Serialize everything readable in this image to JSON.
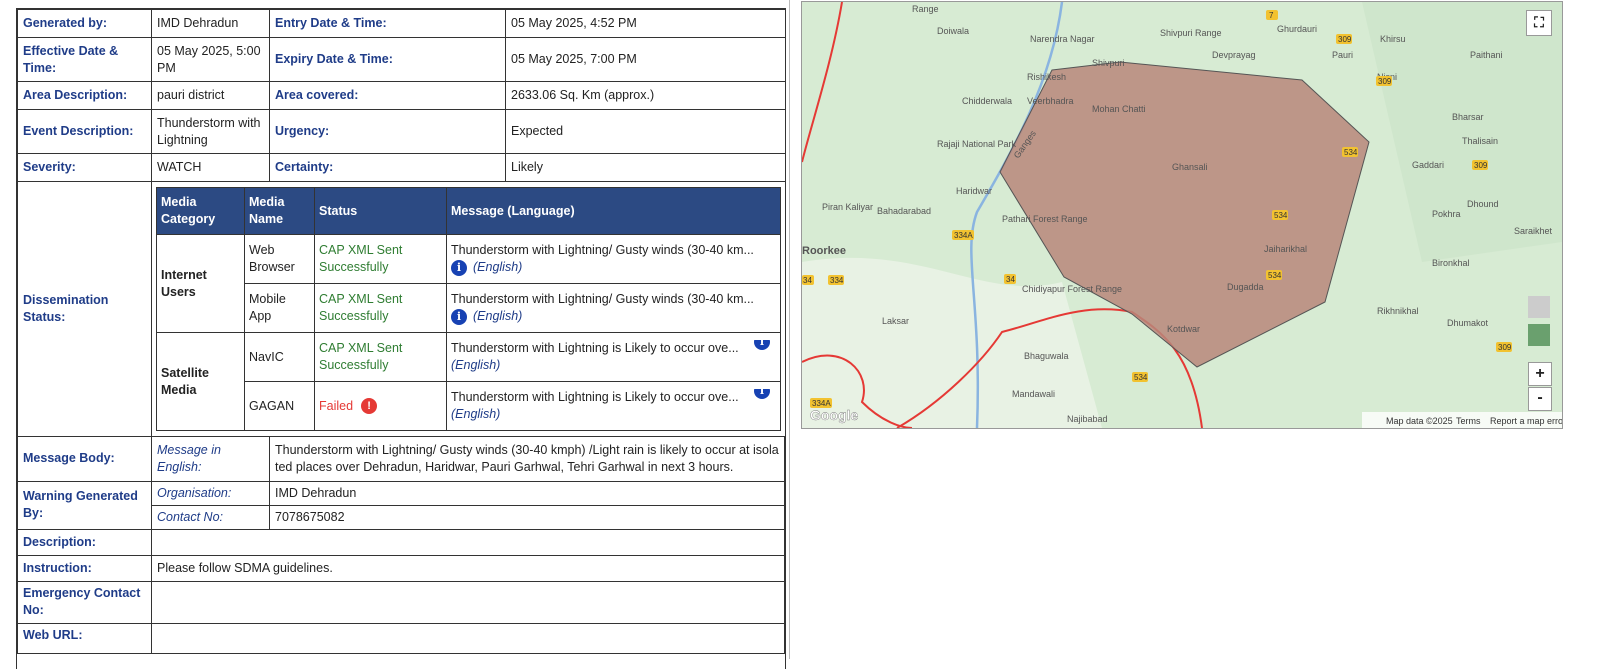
{
  "alert": {
    "generated_by_label": "Generated by:",
    "generated_by": "IMD Dehradun",
    "entry_label": "Entry Date & Time:",
    "entry": "05 May 2025, 4:52 PM",
    "effective_label": "Effective Date & Time:",
    "effective": "05 May 2025, 5:00 PM",
    "expiry_label": "Expiry Date & Time:",
    "expiry": "05 May 2025, 7:00 PM",
    "area_desc_label": "Area Description:",
    "area_desc": "pauri district",
    "area_covered_label": "Area covered:",
    "area_covered": "2633.06 Sq. Km (approx.)",
    "event_label": "Event Description:",
    "event": "Thunderstorm with Lightning",
    "urgency_label": "Urgency:",
    "urgency": "Expected",
    "severity_label": "Severity:",
    "severity": "WATCH",
    "certainty_label": "Certainty:",
    "certainty": "Likely",
    "dissemination_label": "Dissemination Status:"
  },
  "media_table": {
    "headers": [
      "Media Category",
      "Media Name",
      "Status",
      "Message (Language)"
    ],
    "groups": [
      {
        "category": "Internet Users",
        "rows": [
          {
            "name": "Web Browser",
            "status": "CAP XML Sent Successfully",
            "message": "Thunderstorm with Lightning/ Gusty winds (30-40 km...",
            "language": "(English)"
          },
          {
            "name": "Mobile App",
            "status": "CAP XML Sent Successfully",
            "message": "Thunderstorm with Lightning/ Gusty winds (30-40 km...",
            "language": "(English)"
          }
        ]
      },
      {
        "category": "Satellite Media",
        "rows": [
          {
            "name": "NavIC",
            "status": "CAP XML Sent Successfully",
            "message": "Thunderstorm with Lightning is Likely to occur ove...",
            "language": "(English)"
          },
          {
            "name": "GAGAN",
            "status": "Failed",
            "message": "Thunderstorm with Lightning is Likely to occur ove...",
            "language": "(English)"
          }
        ]
      }
    ]
  },
  "details": {
    "message_body_label": "Message Body:",
    "message_in_english_label": "Message in English:",
    "message_in_english": "Thunderstorm with Lightning/ Gusty winds (30-40 kmph) /Light rain is likely to occur at isolated places over Dehradun, Haridwar, Pauri Garhwal, Tehri Garhwal in next 3 hours.",
    "warning_generated_label": "Warning Generated By:",
    "organisation_label": "Organisation:",
    "organisation": "IMD Dehradun",
    "contact_label": "Contact No:",
    "contact": "7078675082",
    "description_label": "Description:",
    "description": "",
    "instruction_label": "Instruction:",
    "instruction": "Please follow SDMA guidelines.",
    "emergency_label": "Emergency Contact No:",
    "emergency": "",
    "web_url_label": "Web URL:",
    "web_url": ""
  },
  "map": {
    "places": [
      "Doiwala",
      "Narendra Nagar",
      "Shivpuri",
      "Shivpuri Range",
      "Devprayag",
      "Ghurdauri",
      "Pauri",
      "Khirsu",
      "Paithani",
      "Nisni",
      "Rishikesh",
      "Chidderwala",
      "Veerbhadra",
      "Mohan Chatti",
      "Rajaji National Park",
      "Ghansali",
      "Bharsar",
      "Thalisain",
      "Gaddari",
      "Haridwar",
      "Piran Kaliyar",
      "Bahadarabad",
      "Pathari Forest Range",
      "Jaiharikhal",
      "Dhound",
      "Pokhra",
      "Saraikhet",
      "Roorkee",
      "Dugadda",
      "Bironkhal",
      "Chidiyapur Forest Range",
      "Laksar",
      "Rikhnikhal",
      "Dhumakot",
      "Kotdwar",
      "Bhaguwala",
      "Mandawali",
      "Najibabad",
      "Ganges",
      "Range"
    ],
    "highways": [
      "7",
      "309",
      "309",
      "334A",
      "534",
      "534",
      "534",
      "309",
      "34",
      "334",
      "34",
      "334A",
      "534",
      "309"
    ],
    "google_logo": "Google",
    "attribution": "Map data ©2025",
    "terms": "Terms",
    "report": "Report a map error",
    "zoom_in": "+",
    "zoom_out": "-",
    "colors": {
      "polygon": "#b8877a",
      "border": "#e53935",
      "land": "#d7ebd3"
    }
  }
}
